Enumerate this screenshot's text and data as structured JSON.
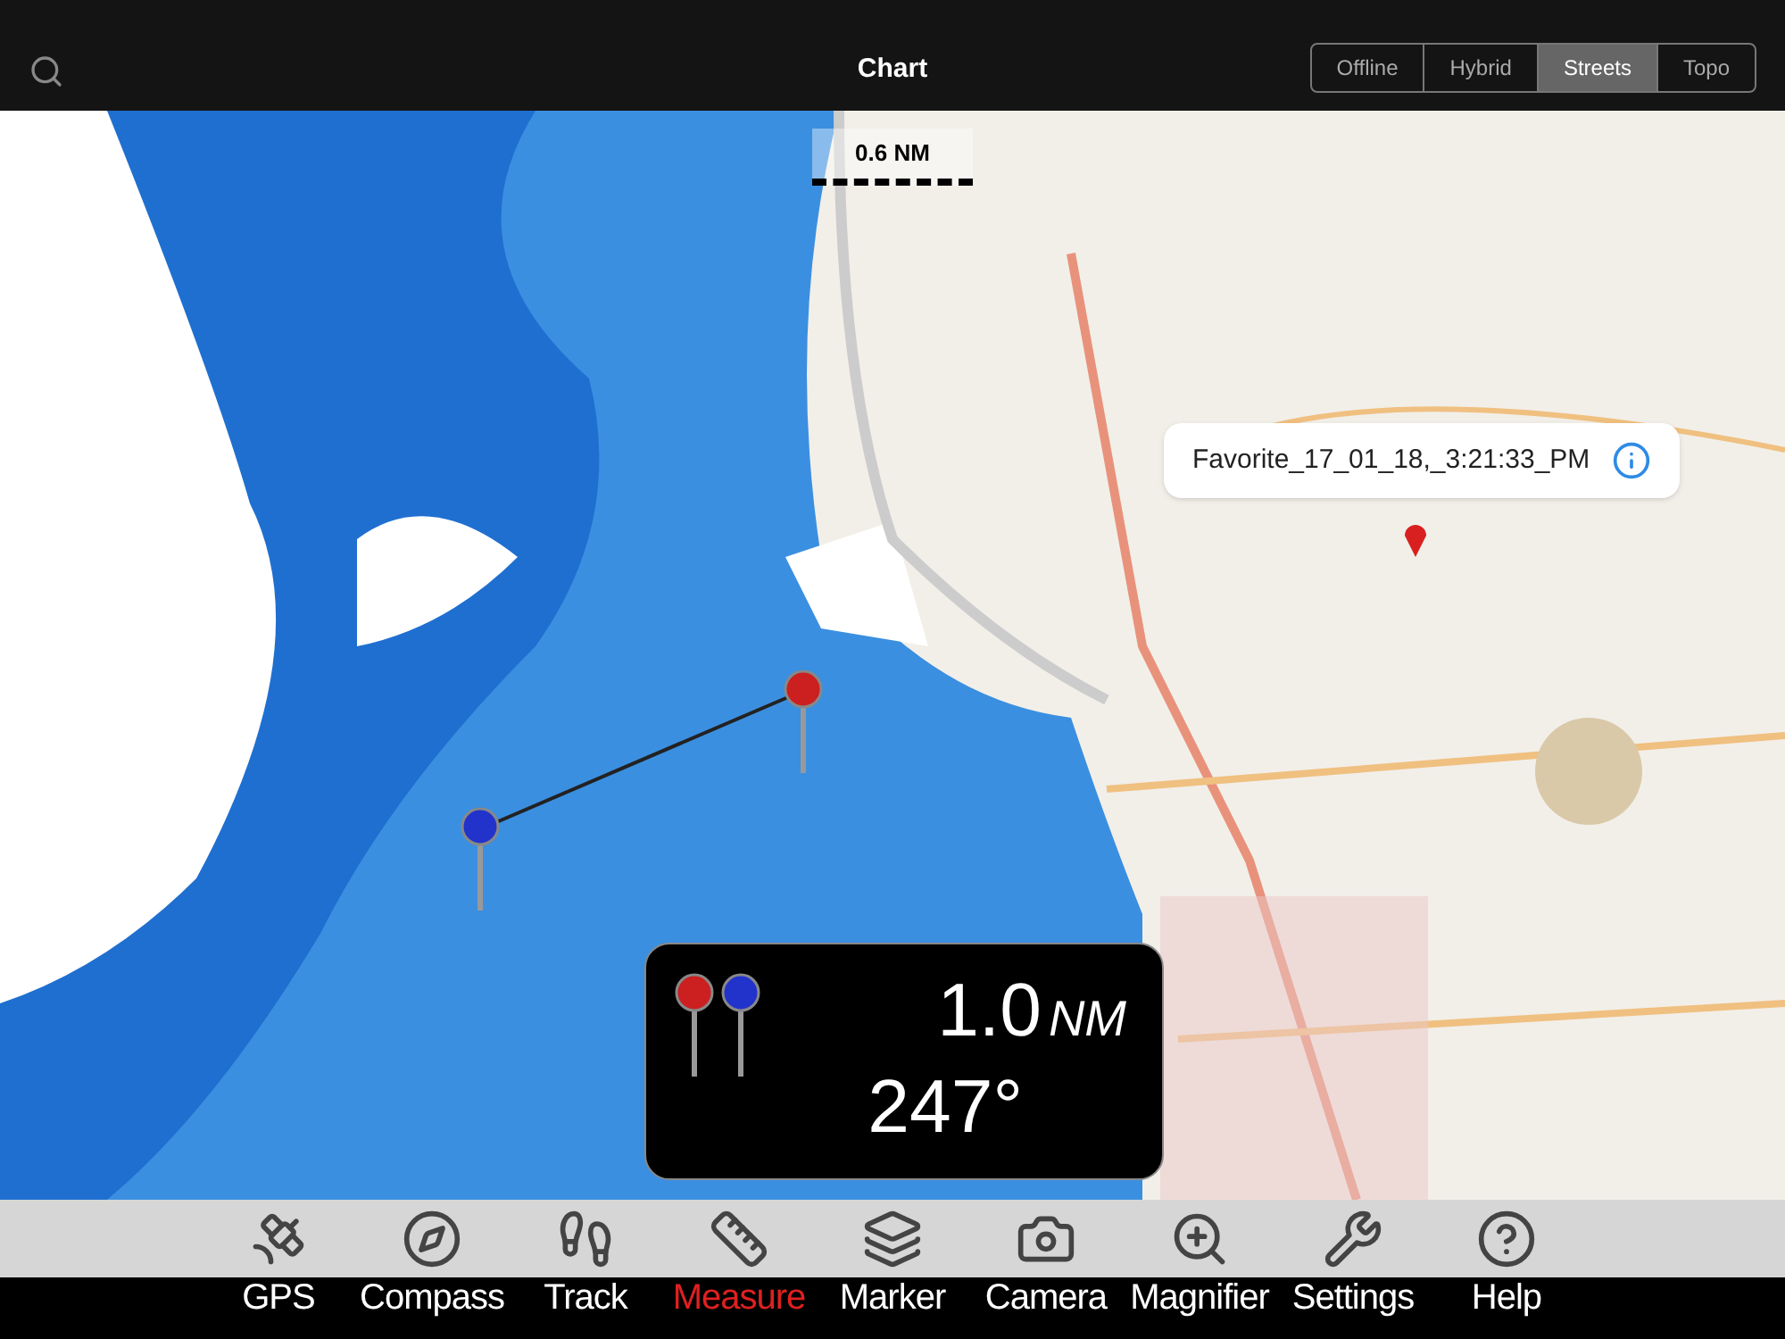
{
  "header": {
    "title": "Chart",
    "map_types": [
      {
        "label": "Offline",
        "selected": false
      },
      {
        "label": "Hybrid",
        "selected": false
      },
      {
        "label": "Streets",
        "selected": true
      },
      {
        "label": "Topo",
        "selected": false
      }
    ]
  },
  "scale_bar": {
    "label": "0.6 NM"
  },
  "favorite_callout": {
    "label": "Favorite_17_01_18,_3:21:33_PM"
  },
  "measurement": {
    "distance": "1.0",
    "unit": "NM",
    "bearing": "247°"
  },
  "toolbar": [
    {
      "label": "GPS",
      "kind": "gps",
      "selected": false
    },
    {
      "label": "Compass",
      "kind": "compass",
      "selected": false
    },
    {
      "label": "Track",
      "kind": "track",
      "selected": false
    },
    {
      "label": "Measure",
      "kind": "measure",
      "selected": true
    },
    {
      "label": "Marker",
      "kind": "marker",
      "selected": false
    },
    {
      "label": "Camera",
      "kind": "camera",
      "selected": false
    },
    {
      "label": "Magnifier",
      "kind": "magnifier",
      "selected": false
    },
    {
      "label": "Settings",
      "kind": "settings",
      "selected": false
    },
    {
      "label": "Help",
      "kind": "help",
      "selected": false
    }
  ]
}
